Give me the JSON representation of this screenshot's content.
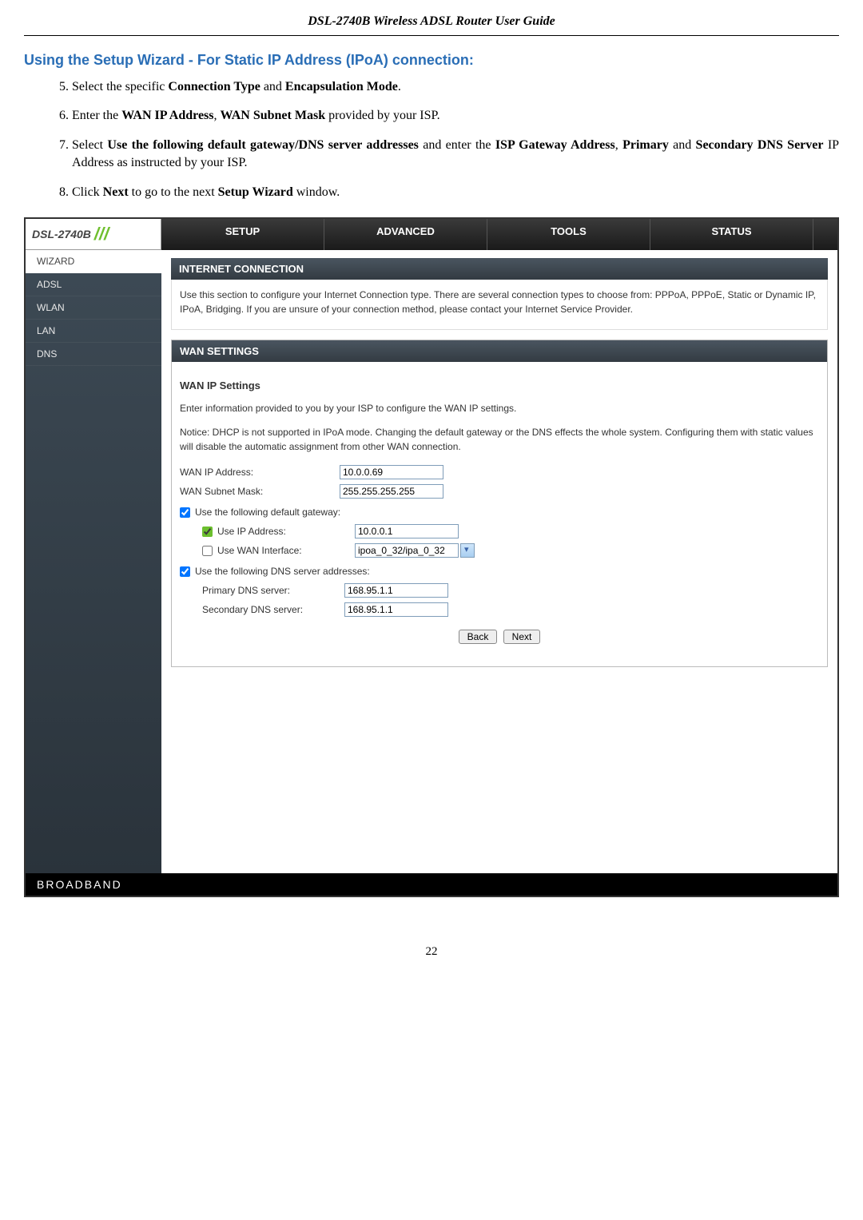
{
  "doc_title": "DSL-2740B Wireless ADSL Router User Guide",
  "section_title": "Using the Setup Wizard - For Static IP Address (IPoA) connection:",
  "instructions": {
    "i5": {
      "num": "5.",
      "html": "Select the specific <b>Connection Type</b> and <b>Encapsulation Mode</b>."
    },
    "i6": {
      "num": "6.",
      "html": "Enter the <b>WAN IP Address</b>, <b>WAN Subnet Mask</b> provided by your ISP."
    },
    "i7": {
      "num": "7.",
      "html": "Select <b>Use the following default gateway/DNS server addresses</b> and enter the <b>ISP Gateway Address</b>, <b>Primary</b> and <b>Secondary DNS Server</b> IP Address as instructed by your ISP."
    },
    "i8": {
      "num": "8.",
      "html": "Click <b>Next</b> to go to the next <b>Setup Wizard</b> window."
    }
  },
  "router": {
    "model": "DSL-2740B",
    "tabs": {
      "setup": "SETUP",
      "advanced": "ADVANCED",
      "tools": "TOOLS",
      "status": "STATUS"
    },
    "sidebar": {
      "wizard": "WIZARD",
      "adsl": "ADSL",
      "wlan": "WLAN",
      "lan": "LAN",
      "dns": "DNS"
    },
    "internet_conn": {
      "title": "INTERNET CONNECTION",
      "desc": "Use this section to configure your Internet Connection type. There are several connection types to choose from: PPPoA, PPPoE, Static or Dynamic IP, IPoA, Bridging. If you are unsure of your connection method, please contact your Internet Service Provider."
    },
    "wan": {
      "title": "WAN SETTINGS",
      "subtitle": "WAN IP Settings",
      "intro": "Enter information provided to you by your ISP to configure the WAN IP settings.",
      "notice": "Notice: DHCP is not supported in IPoA mode. Changing the default gateway or the DNS effects the whole system. Configuring them with static values will disable the automatic assignment from other WAN connection.",
      "labels": {
        "wan_ip": "WAN IP Address:",
        "subnet": "WAN Subnet Mask:",
        "use_gateway": "Use the following default gateway:",
        "use_ip_addr": "Use IP Address:",
        "use_wan_iface": "Use WAN Interface:",
        "use_dns": "Use the following DNS server addresses:",
        "primary_dns": "Primary DNS server:",
        "secondary_dns": "Secondary DNS server:"
      },
      "values": {
        "wan_ip": "10.0.0.69",
        "subnet": "255.255.255.255",
        "use_ip_addr": "10.0.0.1",
        "wan_iface": "ipoa_0_32/ipa_0_32",
        "primary_dns": "168.95.1.1",
        "secondary_dns": "168.95.1.1"
      },
      "checkboxes": {
        "gateway": true,
        "use_ip": true,
        "use_wan_iface": false,
        "use_dns": true
      },
      "buttons": {
        "back": "Back",
        "next": "Next"
      }
    },
    "footer": "BROADBAND"
  },
  "page_number": "22"
}
